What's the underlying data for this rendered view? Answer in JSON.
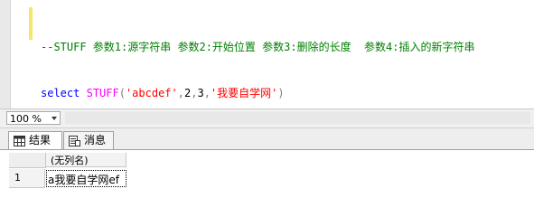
{
  "editor": {
    "line1": {
      "comment": "--STUFF 参数1:源字符串 参数2:开始位置 参数3:删除的长度  参数4:插入的新字符串"
    },
    "line2": {
      "keyword": "select",
      "function": "STUFF",
      "open_paren": "(",
      "arg1": "'abcdef'",
      "sep1": ",",
      "arg2": "2",
      "sep2": ",",
      "arg3": "3",
      "sep3": ",",
      "arg4": "'我要自学网'",
      "close_paren": ")"
    }
  },
  "zoom": {
    "value": "100 %"
  },
  "tabs": [
    {
      "label": "结果",
      "icon": "grid-icon"
    },
    {
      "label": "消息",
      "icon": "messages-icon"
    }
  ],
  "grid": {
    "column_header": "(无列名)",
    "rows": [
      {
        "row_number": "1",
        "value": "a我要自学网ef"
      }
    ]
  }
}
